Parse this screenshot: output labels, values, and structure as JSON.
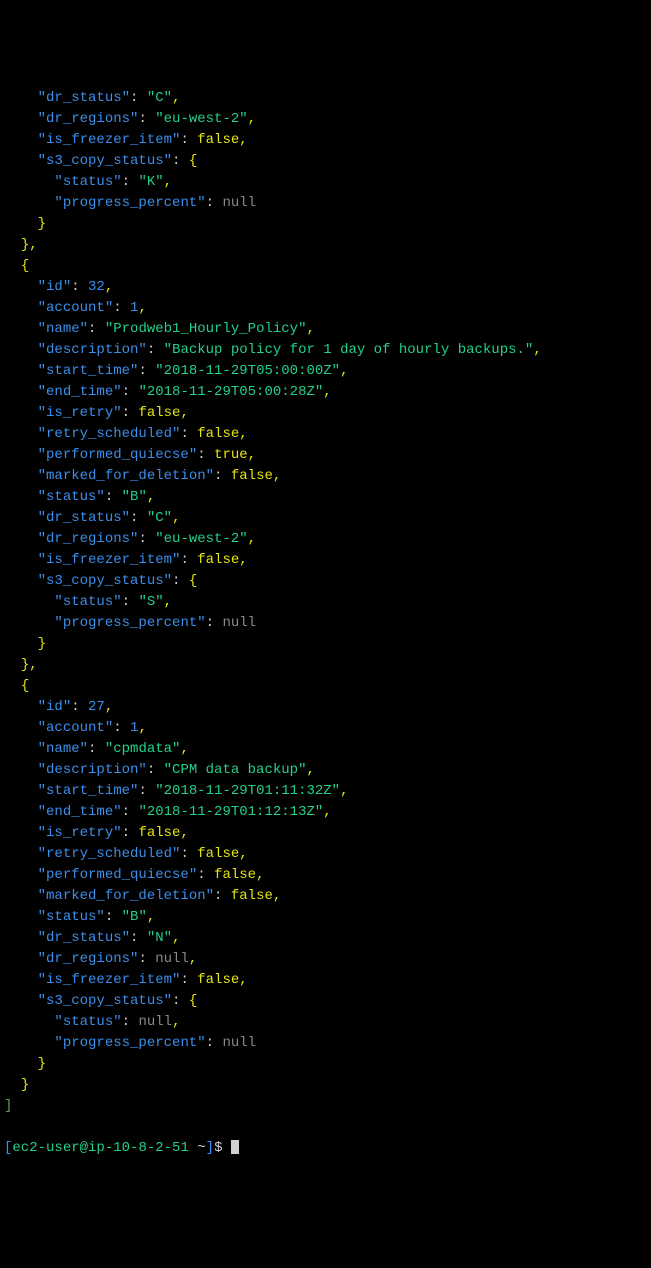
{
  "ind": "  ",
  "records": [
    {
      "partial": true,
      "fields": [
        {
          "key": "dr_status",
          "type": "string",
          "value": "C"
        },
        {
          "key": "dr_regions",
          "type": "string",
          "value": "eu-west-2"
        },
        {
          "key": "is_freezer_item",
          "type": "bool",
          "value": "false"
        },
        {
          "key": "s3_copy_status",
          "type": "object",
          "fields": [
            {
              "key": "status",
              "type": "string",
              "value": "K"
            },
            {
              "key": "progress_percent",
              "type": "null",
              "value": "null"
            }
          ]
        }
      ]
    },
    {
      "partial": false,
      "fields": [
        {
          "key": "id",
          "type": "number",
          "value": "32"
        },
        {
          "key": "account",
          "type": "number",
          "value": "1"
        },
        {
          "key": "name",
          "type": "string",
          "value": "Prodweb1_Hourly_Policy"
        },
        {
          "key": "description",
          "type": "string",
          "value": "Backup policy for 1 day of hourly backups."
        },
        {
          "key": "start_time",
          "type": "string",
          "value": "2018-11-29T05:00:00Z"
        },
        {
          "key": "end_time",
          "type": "string",
          "value": "2018-11-29T05:00:28Z"
        },
        {
          "key": "is_retry",
          "type": "bool",
          "value": "false"
        },
        {
          "key": "retry_scheduled",
          "type": "bool",
          "value": "false"
        },
        {
          "key": "performed_quiecse",
          "type": "bool",
          "value": "true"
        },
        {
          "key": "marked_for_deletion",
          "type": "bool",
          "value": "false"
        },
        {
          "key": "status",
          "type": "string",
          "value": "B"
        },
        {
          "key": "dr_status",
          "type": "string",
          "value": "C"
        },
        {
          "key": "dr_regions",
          "type": "string",
          "value": "eu-west-2"
        },
        {
          "key": "is_freezer_item",
          "type": "bool",
          "value": "false"
        },
        {
          "key": "s3_copy_status",
          "type": "object",
          "fields": [
            {
              "key": "status",
              "type": "string",
              "value": "S"
            },
            {
              "key": "progress_percent",
              "type": "null",
              "value": "null"
            }
          ]
        }
      ]
    },
    {
      "partial": false,
      "fields": [
        {
          "key": "id",
          "type": "number",
          "value": "27"
        },
        {
          "key": "account",
          "type": "number",
          "value": "1"
        },
        {
          "key": "name",
          "type": "string",
          "value": "cpmdata"
        },
        {
          "key": "description",
          "type": "string",
          "value": "CPM data backup"
        },
        {
          "key": "start_time",
          "type": "string",
          "value": "2018-11-29T01:11:32Z"
        },
        {
          "key": "end_time",
          "type": "string",
          "value": "2018-11-29T01:12:13Z"
        },
        {
          "key": "is_retry",
          "type": "bool",
          "value": "false"
        },
        {
          "key": "retry_scheduled",
          "type": "bool",
          "value": "false"
        },
        {
          "key": "performed_quiecse",
          "type": "bool",
          "value": "false"
        },
        {
          "key": "marked_for_deletion",
          "type": "bool",
          "value": "false"
        },
        {
          "key": "status",
          "type": "string",
          "value": "B"
        },
        {
          "key": "dr_status",
          "type": "string",
          "value": "N"
        },
        {
          "key": "dr_regions",
          "type": "null",
          "value": "null"
        },
        {
          "key": "is_freezer_item",
          "type": "bool",
          "value": "false"
        },
        {
          "key": "s3_copy_status",
          "type": "object",
          "fields": [
            {
              "key": "status",
              "type": "null",
              "value": "null"
            },
            {
              "key": "progress_percent",
              "type": "null",
              "value": "null"
            }
          ]
        }
      ]
    }
  ],
  "prompt": {
    "open": "[",
    "user": "ec2-user",
    "at": "@",
    "host": "ip-10-8-2-51",
    "path": " ~",
    "close": "]",
    "dollar": "$"
  }
}
